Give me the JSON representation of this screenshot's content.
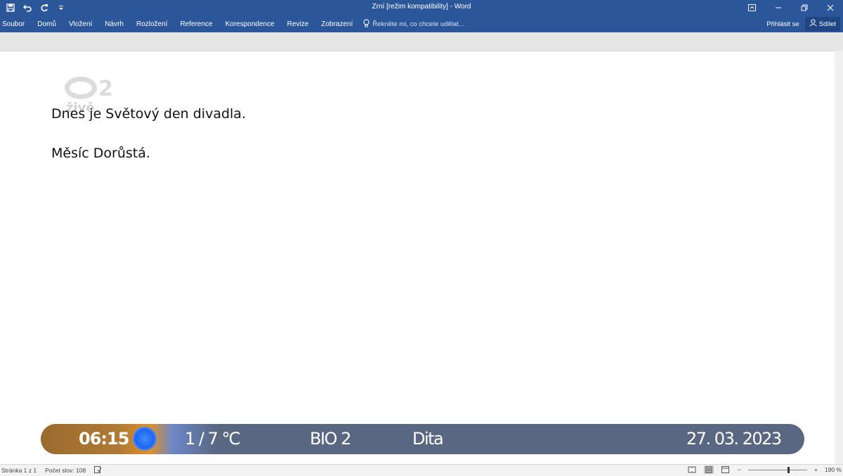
{
  "titlebar": {
    "title": "Zrní [režim kompatibility] - Word",
    "qat_icons": [
      "save-icon",
      "undo-icon",
      "redo-icon",
      "customize-qat-icon"
    ],
    "window_controls": [
      "ribbon-display-options-icon",
      "minimize-icon",
      "restore-icon",
      "close-icon"
    ]
  },
  "ribbon": {
    "tabs": [
      "Soubor",
      "Domů",
      "Vložení",
      "Návrh",
      "Rozložení",
      "Reference",
      "Korespondence",
      "Revize",
      "Zobrazení"
    ],
    "tell_me": "Řekněte mi, co chcete udělat...",
    "sign_in": "Přihlásit se",
    "share": "Sdílet"
  },
  "document": {
    "paragraphs": [
      "Dnes je Světový den divadla.",
      "Měsíc Dorůstá."
    ]
  },
  "watermark": {
    "number": "2",
    "text": "živě"
  },
  "infobar": {
    "time": "06:15",
    "temperature": "1 / 7 ℃",
    "program": "BIO 2",
    "name": "Dita",
    "date": "27. 03. 2023",
    "colors": {
      "bar": "#596782",
      "time_accent": "#e09025",
      "dot": "#2f7cff"
    }
  },
  "statusbar": {
    "page": "Stránka 1 z 1",
    "words": "Počet slov: 108",
    "zoom": "190 %"
  },
  "colors": {
    "accent": "#2b579a"
  }
}
